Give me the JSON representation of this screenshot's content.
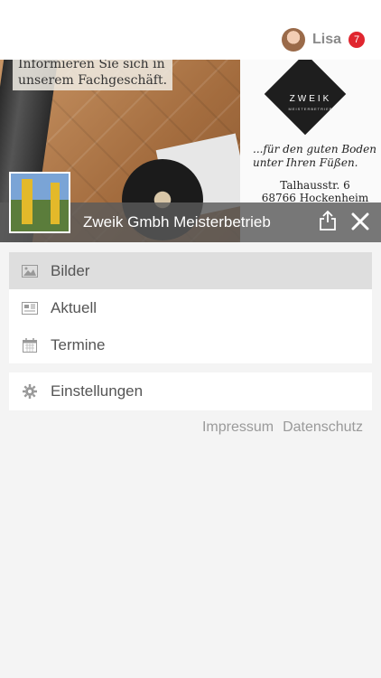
{
  "header": {
    "username": "Lisa",
    "notification_count": "7"
  },
  "hero": {
    "overlay_text": [
      "Informieren Sie sich in",
      "unserem Fachgeschäft."
    ],
    "logo_name": "ZWEIK",
    "logo_sub": "MEISTERBETRIEB",
    "tagline": [
      "...für den guten Boden",
      "unter Ihren Füßen."
    ],
    "address": [
      "Talhausstr. 6",
      "68766 Hockenheim"
    ]
  },
  "titlebar": {
    "title": "Zweik Gmbh Meisterbetrieb"
  },
  "menu": {
    "items": [
      {
        "label": "Bilder",
        "icon": "image-icon"
      },
      {
        "label": "Aktuell",
        "icon": "newspaper-icon"
      },
      {
        "label": "Termine",
        "icon": "calendar-icon"
      }
    ],
    "settings_label": "Einstellungen"
  },
  "footer": {
    "impressum": "Impressum",
    "datenschutz": "Datenschutz"
  },
  "colors": {
    "badge": "#e0262f",
    "titlebar": "#5a5a5a",
    "active_item": "#dedede"
  }
}
